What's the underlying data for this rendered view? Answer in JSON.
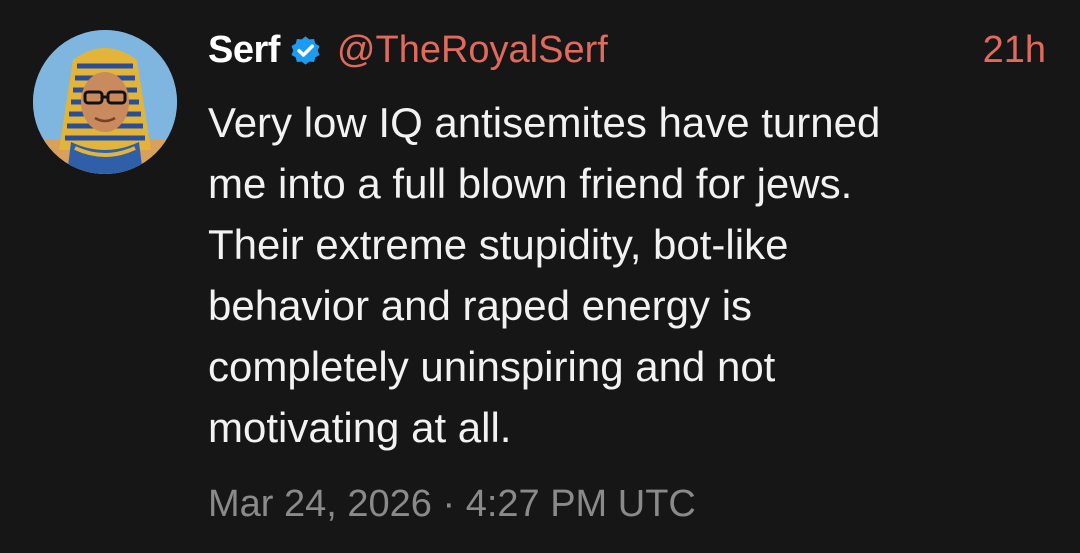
{
  "tweet": {
    "author_name": "Serf",
    "handle": "@TheRoyalSerf",
    "time_ago": "21h",
    "text": "Very low IQ antisemites have turned\nme into a full blown friend for jews.\nTheir extreme stupidity, bot-like\nbehavior and raped energy is\ncompletely uninspiring and not\nmotivating at all.",
    "timestamp": "Mar 24, 2026 · 4:27 PM UTC",
    "avatar_icon": "pharaoh-avatar",
    "verified_icon": "verified-badge-icon"
  },
  "colors": {
    "background": "#161616",
    "text": "#f2f2f2",
    "accent": "#e06a5c",
    "muted": "#8a8a8a",
    "verified": "#1d9bf0"
  }
}
